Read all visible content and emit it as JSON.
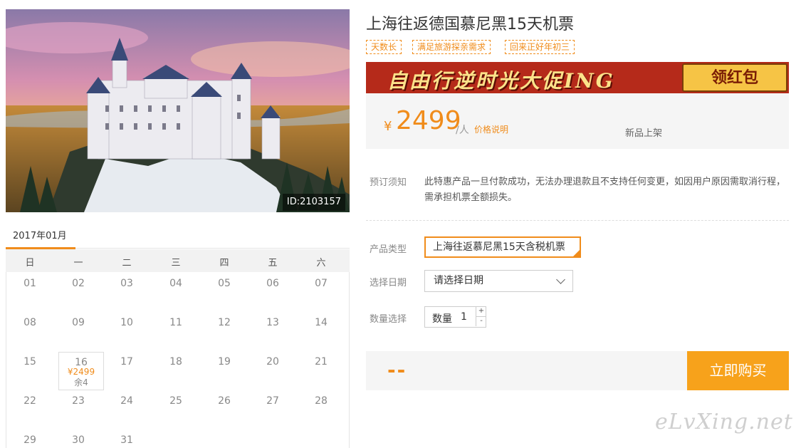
{
  "hero": {
    "image_id": "ID:2103157"
  },
  "calendar": {
    "month": "2017年01月",
    "weekdays": [
      "日",
      "一",
      "二",
      "三",
      "四",
      "五",
      "六"
    ],
    "weeks": [
      [
        "01",
        "02",
        "03",
        "04",
        "05",
        "06",
        "07"
      ],
      [
        "08",
        "09",
        "10",
        "11",
        "12",
        "13",
        "14"
      ],
      [
        "15",
        "16",
        "17",
        "18",
        "19",
        "20",
        "21"
      ],
      [
        "22",
        "23",
        "24",
        "25",
        "26",
        "27",
        "28"
      ],
      [
        "29",
        "30",
        "31",
        "",
        "",
        "",
        ""
      ]
    ],
    "selected": {
      "day": "16",
      "price": "¥2499",
      "remaining": "余4"
    }
  },
  "product": {
    "title": "上海往返德国慕尼黑15天机票",
    "tags": [
      "天数长",
      "满足旅游探亲需求",
      "回来正好年初三"
    ],
    "promo": {
      "text": "自由行逆时光大促ING",
      "button": "领红包"
    },
    "price": {
      "currency": "¥",
      "value": "2499",
      "unit": "/人",
      "note": "价格说明",
      "status": "新品上架"
    },
    "notice": {
      "label": "预订须知",
      "text": "此特惠产品一旦付款成功，无法办理退款且不支持任何变更，如因用户原因需取消行程，需承担机票全额损失。"
    },
    "type": {
      "label": "产品类型",
      "option": "上海往返慕尼黑15天含税机票"
    },
    "date": {
      "label": "选择日期",
      "placeholder": "请选择日期"
    },
    "quantity": {
      "label": "数量选择",
      "field_label": "数量",
      "value": "1",
      "inc": "+",
      "dec": "-"
    },
    "buy": {
      "total": "--",
      "button": "立即购买"
    }
  },
  "watermark": "eLvXing.net",
  "colors": {
    "accent": "#f08c1b",
    "buy": "#f7a21b",
    "promo_bg": "#b52a1a"
  }
}
